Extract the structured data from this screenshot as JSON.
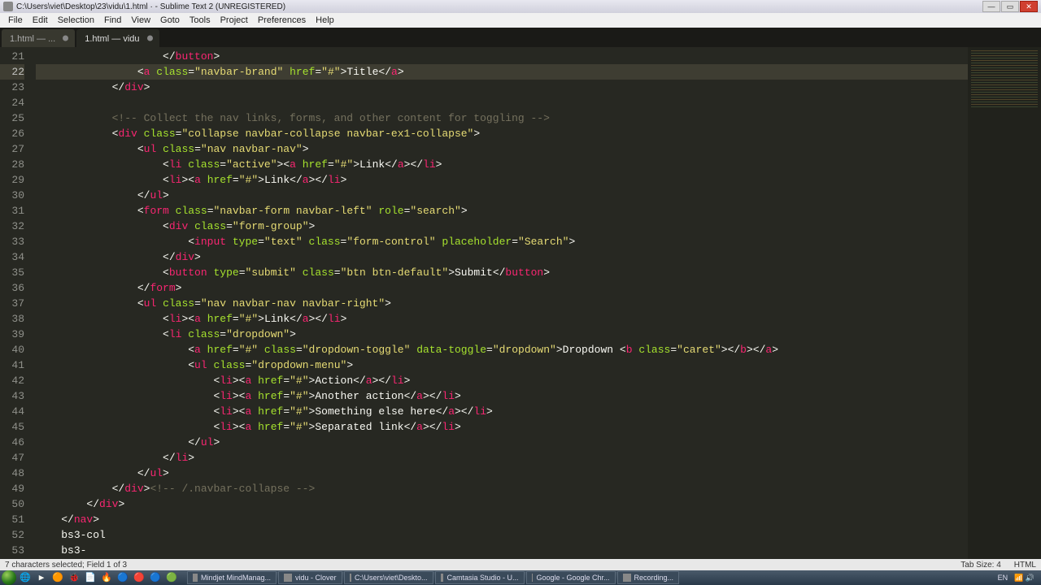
{
  "window": {
    "title": "C:\\Users\\viet\\Desktop\\23\\vidu\\1.html · - Sublime Text 2 (UNREGISTERED)"
  },
  "menu": [
    "File",
    "Edit",
    "Selection",
    "Find",
    "View",
    "Goto",
    "Tools",
    "Project",
    "Preferences",
    "Help"
  ],
  "tabs": [
    {
      "label": "1.html — ...",
      "active": false,
      "dirty": true
    },
    {
      "label": "1.html — vidu",
      "active": true,
      "dirty": true
    }
  ],
  "status": {
    "left": "7 characters selected; Field 1 of 3",
    "tabsize": "Tab Size: 4",
    "syntax": "HTML"
  },
  "editor": {
    "first_line": 21,
    "active_line": 22,
    "lines": [
      {
        "indent": 20,
        "kind": "close",
        "tag": "button"
      },
      {
        "indent": 16,
        "kind": "a_brand",
        "text": "Title",
        "cls": "navbar-brand",
        "href": "#"
      },
      {
        "indent": 12,
        "kind": "close",
        "tag": "div"
      },
      {
        "indent": 0,
        "kind": "blank"
      },
      {
        "indent": 12,
        "kind": "comment",
        "text": "Collect the nav links, forms, and other content for toggling"
      },
      {
        "indent": 12,
        "kind": "open",
        "tag": "div",
        "attrs": [
          [
            "class",
            "collapse navbar-collapse navbar-ex1-collapse"
          ]
        ]
      },
      {
        "indent": 16,
        "kind": "open",
        "tag": "ul",
        "attrs": [
          [
            "class",
            "nav navbar-nav"
          ]
        ]
      },
      {
        "indent": 20,
        "kind": "li_active_link",
        "text": "Link"
      },
      {
        "indent": 20,
        "kind": "li_link",
        "text": "Link"
      },
      {
        "indent": 16,
        "kind": "close",
        "tag": "ul"
      },
      {
        "indent": 16,
        "kind": "open",
        "tag": "form",
        "attrs": [
          [
            "class",
            "navbar-form navbar-left"
          ],
          [
            "role",
            "search"
          ]
        ]
      },
      {
        "indent": 20,
        "kind": "open",
        "tag": "div",
        "attrs": [
          [
            "class",
            "form-group"
          ]
        ]
      },
      {
        "indent": 24,
        "kind": "input",
        "attrs": [
          [
            "type",
            "text"
          ],
          [
            "class",
            "form-control"
          ],
          [
            "placeholder",
            "Search"
          ]
        ]
      },
      {
        "indent": 20,
        "kind": "close",
        "tag": "div"
      },
      {
        "indent": 20,
        "kind": "button_submit",
        "text": "Submit"
      },
      {
        "indent": 16,
        "kind": "close",
        "tag": "form"
      },
      {
        "indent": 16,
        "kind": "open",
        "tag": "ul",
        "attrs": [
          [
            "class",
            "nav navbar-nav navbar-right"
          ]
        ]
      },
      {
        "indent": 20,
        "kind": "li_link",
        "text": "Link"
      },
      {
        "indent": 20,
        "kind": "open",
        "tag": "li",
        "attrs": [
          [
            "class",
            "dropdown"
          ]
        ]
      },
      {
        "indent": 24,
        "kind": "dropdown_toggle",
        "text": "Dropdown"
      },
      {
        "indent": 24,
        "kind": "open",
        "tag": "ul",
        "attrs": [
          [
            "class",
            "dropdown-menu"
          ]
        ]
      },
      {
        "indent": 28,
        "kind": "li_link",
        "text": "Action"
      },
      {
        "indent": 28,
        "kind": "li_link",
        "text": "Another action"
      },
      {
        "indent": 28,
        "kind": "li_link",
        "text": "Something else here"
      },
      {
        "indent": 28,
        "kind": "li_link",
        "text": "Separated link"
      },
      {
        "indent": 24,
        "kind": "close",
        "tag": "ul"
      },
      {
        "indent": 20,
        "kind": "close",
        "tag": "li"
      },
      {
        "indent": 16,
        "kind": "close",
        "tag": "ul"
      },
      {
        "indent": 12,
        "kind": "close_with_comment",
        "tag": "div",
        "comment": "/.navbar-collapse"
      },
      {
        "indent": 8,
        "kind": "close",
        "tag": "div"
      },
      {
        "indent": 4,
        "kind": "close",
        "tag": "nav"
      },
      {
        "indent": 4,
        "kind": "plain",
        "text": "bs3-col"
      },
      {
        "indent": 4,
        "kind": "plain",
        "text": "bs3-"
      }
    ]
  },
  "taskbar": {
    "quick": [
      "🌐",
      "▶",
      "🟠",
      "🐞",
      "📄",
      "🔥",
      "🔵",
      "🔴",
      "🔵",
      "🟢"
    ],
    "apps": [
      "Mindjet MindManag...",
      "vidu - Clover",
      "C:\\Users\\viet\\Deskto...",
      "Camtasia Studio - U...",
      "Google - Google Chr...",
      "Recording..."
    ],
    "lang": "EN",
    "sys": [
      "📶",
      "🔊"
    ]
  }
}
